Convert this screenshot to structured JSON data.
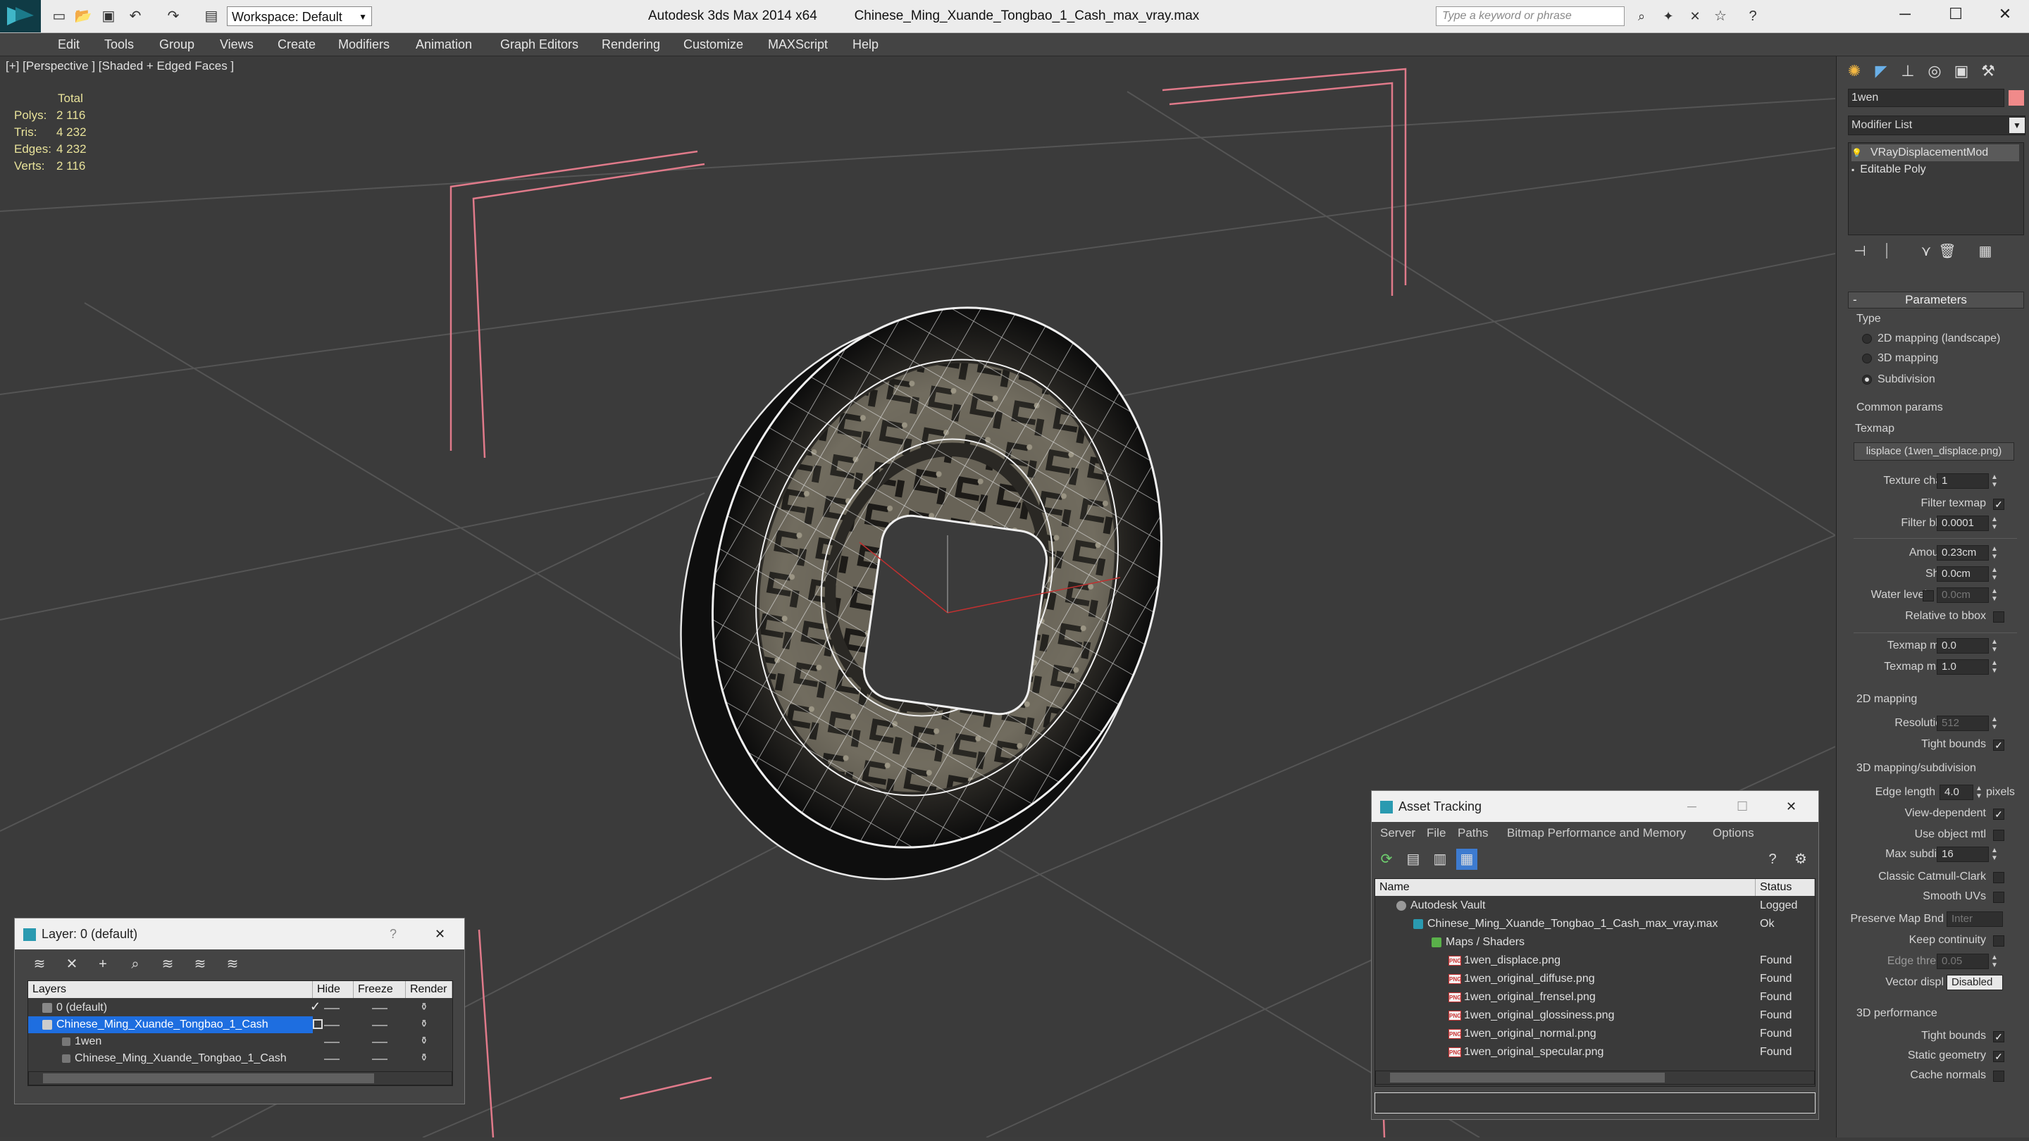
{
  "window": {
    "app_title": "Autodesk 3ds Max 2014 x64",
    "file_title": "Chinese_Ming_Xuande_Tongbao_1_Cash_max_vray.max",
    "workspace": "Workspace: Default",
    "search_placeholder": "Type a keyword or phrase"
  },
  "menu": [
    "Edit",
    "Tools",
    "Group",
    "Views",
    "Create",
    "Modifiers",
    "Animation",
    "Graph Editors",
    "Rendering",
    "Customize",
    "MAXScript",
    "Help"
  ],
  "viewport": {
    "label": "[+] [Perspective ] [Shaded + Edged Faces ]",
    "stats_header": "Total",
    "stats": [
      {
        "label": "Polys:",
        "value": "2 116"
      },
      {
        "label": "Tris:",
        "value": "4 232"
      },
      {
        "label": "Edges:",
        "value": "4 232"
      },
      {
        "label": "Verts:",
        "value": "2 116"
      }
    ]
  },
  "command_panel": {
    "object_name": "1wen",
    "object_color": "#f08a8a",
    "modifier_list_label": "Modifier List",
    "stack": [
      "VRayDisplacementMod",
      "Editable Poly"
    ],
    "rollout_title": "Parameters",
    "type_group": "Type",
    "type_options": [
      {
        "label": "2D mapping (landscape)",
        "selected": false
      },
      {
        "label": "3D mapping",
        "selected": false
      },
      {
        "label": "Subdivision",
        "selected": true
      }
    ],
    "common_group": "Common params",
    "texmap_label": "Texmap",
    "texmap_value": "lisplace (1wen_displace.png)",
    "texture_chan_label": "Texture chan",
    "texture_chan_value": "1",
    "filter_texmap_label": "Filter texmap",
    "filter_texmap": true,
    "filter_blur_label": "Filter blur",
    "filter_blur_value": "0.0001",
    "amount_label": "Amount",
    "amount_value": "0.23cm",
    "shift_label": "Shift",
    "shift_value": "0.0cm",
    "water_level_label": "Water level",
    "water_level_value": "0.0cm",
    "relative_bbox_label": "Relative to bbox",
    "texmap_min_label": "Texmap min",
    "texmap_min_value": "0.0",
    "texmap_max_label": "Texmap max",
    "texmap_max_value": "1.0",
    "mapping2d_group": "2D mapping",
    "resolution_label": "Resolution",
    "resolution_value": "512",
    "tight_bounds_label": "Tight bounds",
    "mapping3d_group": "3D mapping/subdivision",
    "edge_length_label": "Edge length",
    "edge_length_value": "4.0",
    "pixels_label": "pixels",
    "view_dependent_label": "View-dependent",
    "use_object_mtl_label": "Use object mtl",
    "max_subdivs_label": "Max subdivs",
    "max_subdivs_value": "16",
    "classic_catmull_label": "Classic Catmull-Clark",
    "smooth_uvs_label": "Smooth UVs",
    "preserve_map_bnd_label": "Preserve Map Bnd",
    "preserve_map_bnd_value": "Inter",
    "keep_continuity_label": "Keep continuity",
    "edge_thresh_label": "Edge thresh",
    "edge_thresh_value": "0.05",
    "vector_displ_label": "Vector displ",
    "vector_displ_value": "Disabled",
    "perf_group": "3D performance",
    "perf_tight_bounds_label": "Tight bounds",
    "static_geometry_label": "Static geometry",
    "cache_normals_label": "Cache normals"
  },
  "layer_window": {
    "title": "Layer: 0 (default)",
    "columns": [
      "Layers",
      "Hide",
      "Freeze",
      "Render"
    ],
    "rows": [
      {
        "name": "0 (default)",
        "indent": 0
      },
      {
        "name": "Chinese_Ming_Xuande_Tongbao_1_Cash",
        "indent": 0
      },
      {
        "name": "1wen",
        "indent": 1
      },
      {
        "name": "Chinese_Ming_Xuande_Tongbao_1_Cash",
        "indent": 1
      }
    ]
  },
  "asset_window": {
    "title": "Asset Tracking",
    "menu": [
      "Server",
      "File",
      "Paths",
      "Bitmap Performance and Memory",
      "Options"
    ],
    "columns": [
      "Name",
      "Status"
    ],
    "rows": [
      {
        "name": "Autodesk Vault",
        "status": "Logged",
        "indent": 0
      },
      {
        "name": "Chinese_Ming_Xuande_Tongbao_1_Cash_max_vray.max",
        "status": "Ok",
        "indent": 1
      },
      {
        "name": "Maps / Shaders",
        "status": "",
        "indent": 2
      },
      {
        "name": "1wen_displace.png",
        "status": "Found",
        "indent": 3
      },
      {
        "name": "1wen_original_diffuse.png",
        "status": "Found",
        "indent": 3
      },
      {
        "name": "1wen_original_frensel.png",
        "status": "Found",
        "indent": 3
      },
      {
        "name": "1wen_original_glossiness.png",
        "status": "Found",
        "indent": 3
      },
      {
        "name": "1wen_original_normal.png",
        "status": "Found",
        "indent": 3
      },
      {
        "name": "1wen_original_specular.png",
        "status": "Found",
        "indent": 3
      }
    ]
  }
}
